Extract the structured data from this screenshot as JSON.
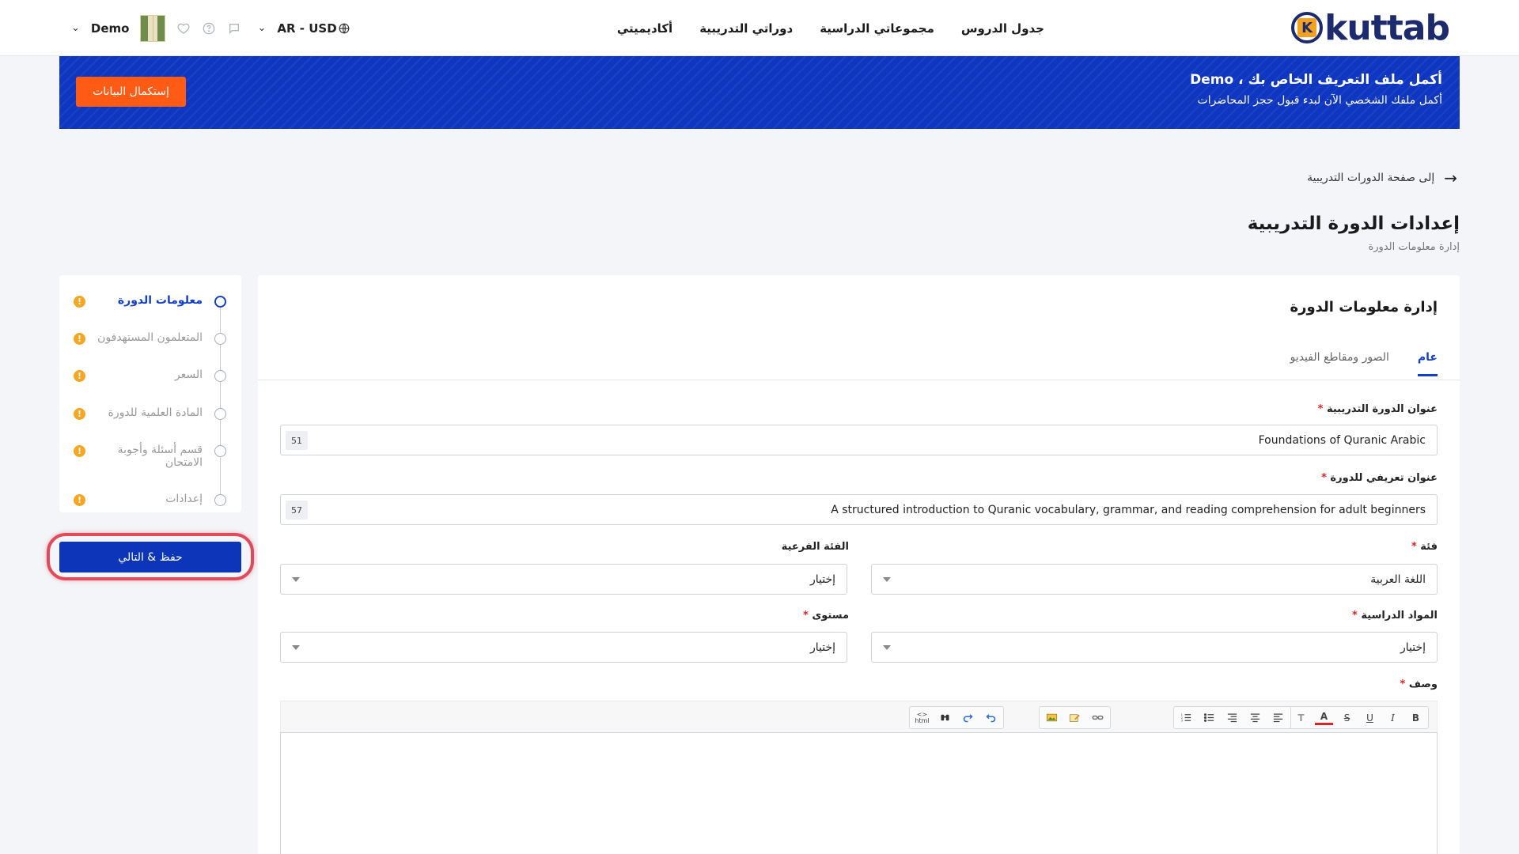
{
  "header": {
    "logo_text": "kuttab",
    "logo_letter": "K",
    "nav": [
      "جدول الدروس",
      "مجموعاتي الدراسية",
      "دوراتي التدريبية",
      "أكاديميتي"
    ],
    "user_name": "Demo",
    "language": "AR - USD",
    "icons": [
      "chevron-down-icon",
      "avatar",
      "heart-icon",
      "help-circle-icon",
      "chat-icon",
      "globe-icon"
    ]
  },
  "banner": {
    "title": "أكمل ملف التعريف الخاص بك ، Demo",
    "subtitle": "أكمل ملفك الشخصي الآن لبدء قبول حجز المحاضرات",
    "button": "إستكمال البيانات",
    "color": "#0e36c0",
    "button_color": "#ff5b14"
  },
  "back_link": "إلى صفحة الدورات التدريبية",
  "page": {
    "title": "إعدادات الدورة التدريبية",
    "subtitle": "إدارة معلومات الدورة"
  },
  "steps": [
    {
      "label": "معلومات الدورة",
      "active": true
    },
    {
      "label": "المتعلمون المستهدفون",
      "active": false
    },
    {
      "label": "السعر",
      "active": false
    },
    {
      "label": "المادة العلمية للدورة",
      "active": false
    },
    {
      "label": "قسم أسئلة وأجوبة الامتحان",
      "active": false
    },
    {
      "label": "إعدادات",
      "active": false
    }
  ],
  "save_button": "حفظ & التالي",
  "card": {
    "title": "إدارة معلومات الدورة",
    "tabs": [
      {
        "label": "عام",
        "active": true
      },
      {
        "label": "الصور ومقاطع الفيديو",
        "active": false
      }
    ]
  },
  "form": {
    "course_title_label": "عنوان الدورة التدريبية",
    "course_title_value": "Foundations of Quranic Arabic",
    "course_title_count": "51",
    "intro_title_label": "عنوان تعريفي للدورة",
    "intro_title_value": "A structured introduction to Quranic vocabulary, grammar, and reading comprehension for adult beginners",
    "intro_title_count": "57",
    "category_label": "فئة",
    "category_value": "اللغة العربية",
    "subcategory_label": "الفئة الفرعية",
    "subcategory_value": "إختيار",
    "subjects_label": "المواد الدراسية",
    "subjects_value": "إختيار",
    "level_label": "مستوى",
    "level_value": "إختيار",
    "description_label": "وصف",
    "required_mark": "*"
  },
  "colors": {
    "primary": "#0d35b9",
    "accent_orange": "#ff5b14",
    "warning": "#f5a623",
    "required": "#e02424",
    "highlight_ring": "#e14a5a"
  }
}
